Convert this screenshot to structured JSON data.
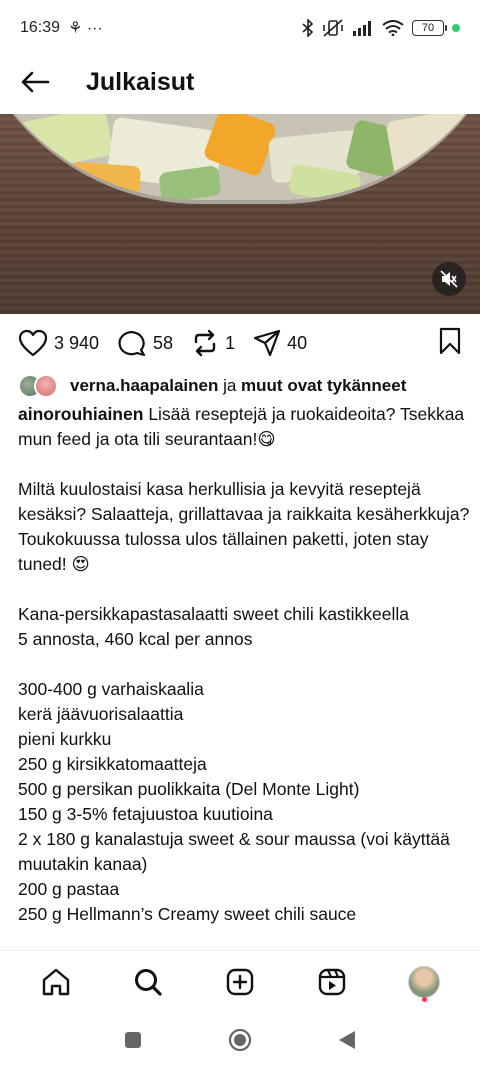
{
  "status_bar": {
    "time": "16:39",
    "extra": "⚘ ···",
    "battery": "70"
  },
  "header": {
    "title": "Julkaisut"
  },
  "post": {
    "actions": {
      "likes": "3 940",
      "comments": "58",
      "reposts": "1",
      "shares": "40"
    },
    "liked_by": {
      "user": "verna.haapalainen",
      "connector": "ja",
      "others": "muut ovat tykänneet"
    },
    "caption": {
      "username": "ainorouhiainen",
      "lines": [
        "Lisää reseptejä ja ruokaideoita? Tsekkaa mun feed ja ota tili seurantaan!😋",
        "",
        "Miltä kuulostaisi kasa herkullisia ja kevyitä reseptejä kesäksi? Salaatteja, grillattavaa ja raikkaita kesäherkkuja? Toukokuussa tulossa ulos tällainen paketti, joten stay tuned! 😍",
        "",
        "Kana-persikkapastasalaatti sweet chili kastikkeella",
        "5 annosta, 460 kcal per annos",
        "",
        "300-400 g varhaiskaalia",
        "kerä jäävuorisalaattia",
        "pieni kurkku",
        "250 g kirsikkatomaatteja",
        "500 g persikan puolikkaita (Del Monte Light)",
        "150 g 3-5% fetajuustoa kuutioina",
        "2 x 180 g kanalastuja sweet & sour maussa (voi käyttää muutakin kanaa)",
        "200 g pastaa",
        "250 g Hellmann’s Creamy sweet chili sauce"
      ]
    }
  },
  "bottom_nav": [
    "home-icon",
    "search-icon",
    "create-icon",
    "reels-icon",
    "profile"
  ],
  "system_nav": [
    "recents",
    "home",
    "back"
  ]
}
